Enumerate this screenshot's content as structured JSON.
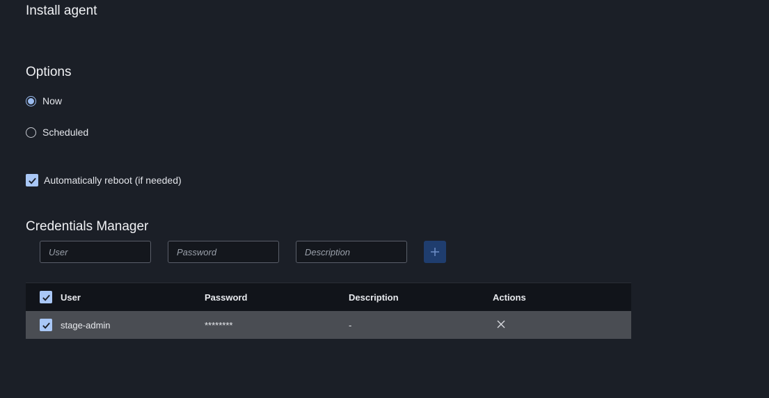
{
  "page": {
    "title": "Install agent"
  },
  "options": {
    "title": "Options",
    "radios": [
      {
        "label": "Now",
        "selected": true
      },
      {
        "label": "Scheduled",
        "selected": false
      }
    ],
    "auto_reboot": {
      "label": "Automatically reboot (if needed)",
      "checked": true
    }
  },
  "credentials": {
    "title": "Credentials Manager",
    "inputs": {
      "user_placeholder": "User",
      "password_placeholder": "Password",
      "description_placeholder": "Description"
    },
    "add_icon": "plus-icon",
    "table": {
      "headers": {
        "user": "User",
        "password": "Password",
        "description": "Description",
        "actions": "Actions"
      },
      "rows": [
        {
          "user": "stage-admin",
          "password": "********",
          "description": "-",
          "checked": true,
          "action_icon": "close-icon"
        }
      ]
    }
  },
  "colors": {
    "background": "#1b1f27",
    "accent": "#9bbcf0",
    "checkbox": "#a9c7f6",
    "add_button": "#1f3d6e",
    "row_selected": "#4a4d53",
    "header_bg": "#11141a"
  }
}
